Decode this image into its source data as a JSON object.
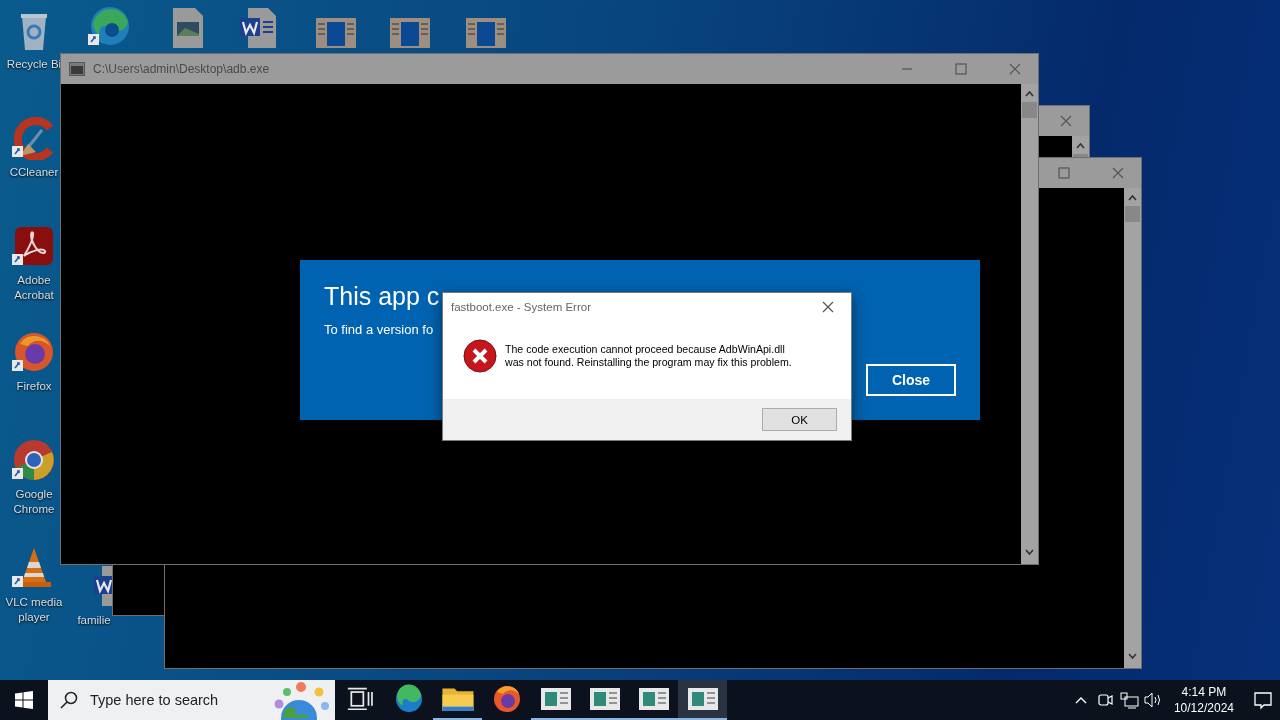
{
  "desktop_icons": [
    {
      "kind": "recycle",
      "label": "Recycle Bi",
      "shortcut": false
    },
    {
      "kind": "edge",
      "shortcut": true
    },
    {
      "kind": "image-file",
      "shortcut": false
    },
    {
      "kind": "word-file",
      "shortcut": false
    },
    {
      "kind": "window",
      "shortcut": false
    },
    {
      "kind": "window",
      "shortcut": false
    },
    {
      "kind": "window",
      "shortcut": false
    },
    {
      "kind": "ccleaner",
      "label": "CCleaner",
      "shortcut": true
    },
    {
      "kind": "acrobat",
      "label": "Adobe Acrobat",
      "shortcut": true
    },
    {
      "kind": "firefox",
      "label": "Firefox",
      "shortcut": true
    },
    {
      "kind": "chrome",
      "label": "Google Chrome",
      "shortcut": true
    },
    {
      "kind": "vlc",
      "label": "VLC media player",
      "shortcut": true
    },
    {
      "kind": "word-file",
      "label": "familie",
      "shortcut": false
    }
  ],
  "console_window": {
    "title": "C:\\Users\\admin\\Desktop\\adb.exe"
  },
  "store_panel": {
    "title": "This app c",
    "text": "To find a version fo",
    "button": "Close"
  },
  "error_dialog": {
    "title": "fastboot.exe - System Error",
    "message_lines": [
      "The code execution cannot proceed because AdbWinApi.dll",
      "was not found. Reinstalling the program may fix this problem."
    ],
    "button": "OK"
  },
  "taskbar": {
    "search_placeholder": "Type here to search",
    "apps": [
      {
        "kind": "task-view",
        "running": false,
        "selected": false
      },
      {
        "kind": "edge",
        "running": false,
        "selected": false
      },
      {
        "kind": "folder",
        "running": true,
        "selected": false
      },
      {
        "kind": "firefox",
        "running": false,
        "selected": false
      },
      {
        "kind": "window",
        "running": true,
        "selected": false
      },
      {
        "kind": "window",
        "running": true,
        "selected": false
      },
      {
        "kind": "window",
        "running": true,
        "selected": false
      },
      {
        "kind": "window",
        "running": true,
        "selected": true
      }
    ],
    "time": "4:14 PM",
    "date": "10/12/2024"
  }
}
